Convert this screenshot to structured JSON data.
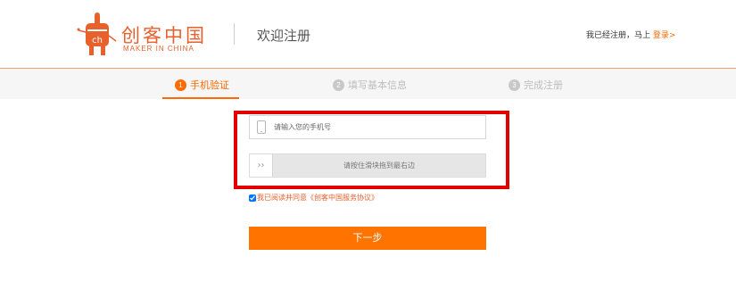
{
  "brand": {
    "name": "创客中国",
    "sub": "MAKER IN CHINA",
    "color": "#e8602c"
  },
  "header": {
    "title": "欢迎注册",
    "already_text": "我已经注册，马上",
    "login_link": "登录>"
  },
  "steps": [
    {
      "num": "1",
      "label": "手机验证",
      "state": "active"
    },
    {
      "num": "2",
      "label": "填写基本信息",
      "state": "inactive"
    },
    {
      "num": "3",
      "label": "完成注册",
      "state": "inactive"
    }
  ],
  "form": {
    "phone_placeholder": "请输入您的手机号",
    "slider_handle": "››",
    "slider_text": "请按住滑块拖到最右边",
    "agree_checked": true,
    "agree_text": "我已阅读并同意《创客中国服务协议》",
    "next_label": "下一步"
  },
  "colors": {
    "accent": "#ff6a00",
    "button": "#ff7300",
    "highlight_box": "#e00000"
  }
}
